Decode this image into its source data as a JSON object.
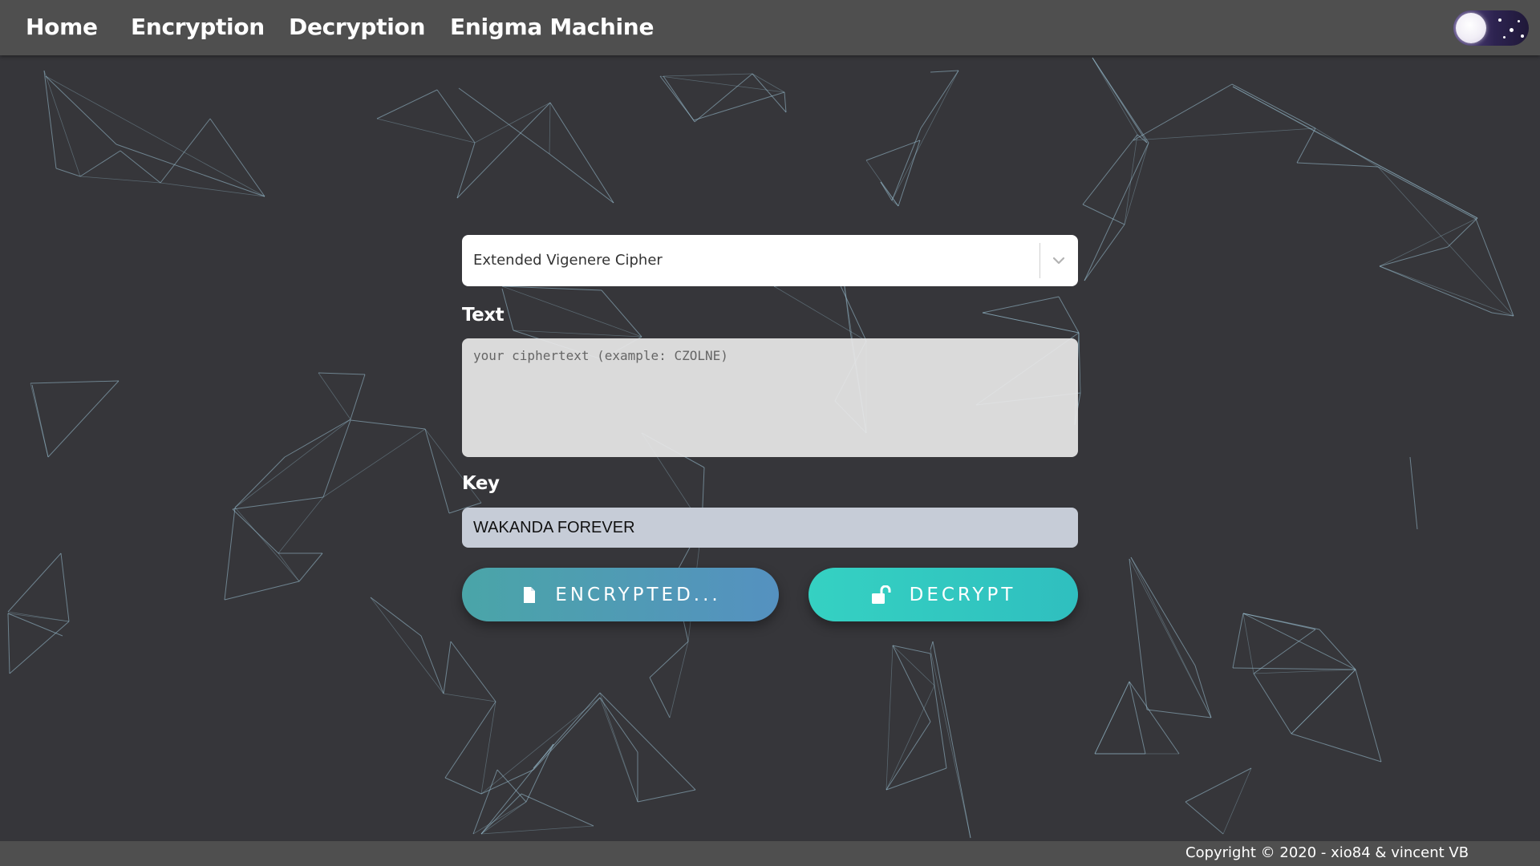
{
  "nav": {
    "home": "Home",
    "encryption": "Encryption",
    "decryption": "Decryption",
    "enigma": "Enigma Machine"
  },
  "theme_toggle": {
    "icon": "moon-icon",
    "state": "dark"
  },
  "form": {
    "cipher_select": {
      "selected": "Extended Vigenere Cipher",
      "icon": "chevron-down-icon"
    },
    "text_label": "Text",
    "text_placeholder": "your ciphertext (example: CZOLNE)",
    "text_value": "",
    "key_label": "Key",
    "key_value": "WAKANDA FOREVER",
    "encrypt_button": {
      "label": "ENCRYPTED...",
      "icon": "file-icon"
    },
    "decrypt_button": {
      "label": "DECRYPT",
      "icon": "unlock-icon"
    }
  },
  "footer": {
    "copyright": "Copyright © 2020 - xio84 & vincent VB"
  },
  "colors": {
    "background": "#36363a",
    "navbar": "#4f4f4f",
    "network_line": "#9cc3d5",
    "encrypt_gradient_start": "#4aa5a8",
    "encrypt_gradient_end": "#5591c0",
    "decrypt_button": "#35d1c2"
  }
}
